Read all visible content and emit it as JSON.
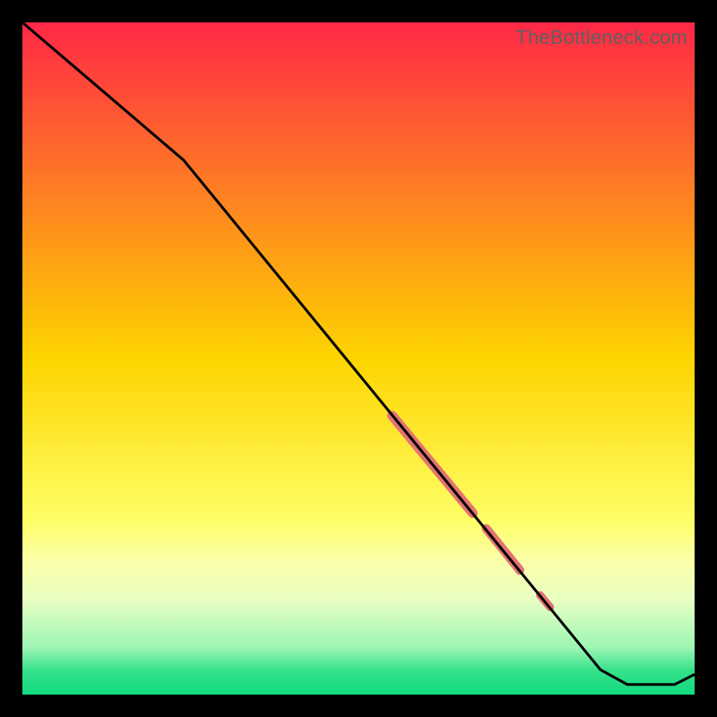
{
  "watermark": "TheBottleneck.com",
  "chart_data": {
    "type": "line",
    "title": "",
    "xlabel": "",
    "ylabel": "",
    "xlim": [
      0,
      100
    ],
    "ylim": [
      0,
      100
    ],
    "gradient_stops": [
      {
        "offset": 0.0,
        "color": "#ff2846"
      },
      {
        "offset": 0.5,
        "color": "#fdd400"
      },
      {
        "offset": 0.74,
        "color": "#ffff66"
      },
      {
        "offset": 0.8,
        "color": "#fbffa8"
      },
      {
        "offset": 0.86,
        "color": "#e8ffc3"
      },
      {
        "offset": 0.93,
        "color": "#9cf6b4"
      },
      {
        "offset": 0.965,
        "color": "#34e08b"
      },
      {
        "offset": 1.0,
        "color": "#11db7e"
      }
    ],
    "series": [
      {
        "name": "bottleneck-curve",
        "color": "#000000",
        "points": [
          {
            "x": 0.0,
            "y": 100.0
          },
          {
            "x": 24.0,
            "y": 79.5
          },
          {
            "x": 86.0,
            "y": 3.7
          },
          {
            "x": 90.0,
            "y": 1.5
          },
          {
            "x": 97.0,
            "y": 1.5
          },
          {
            "x": 100.0,
            "y": 3.0
          }
        ]
      }
    ],
    "highlight_segments": [
      {
        "x1": 55.0,
        "y1": 41.5,
        "x2": 67.0,
        "y2": 27.0,
        "width": 11
      },
      {
        "x1": 69.0,
        "y1": 24.7,
        "x2": 74.0,
        "y2": 18.5,
        "width": 10
      },
      {
        "x1": 77.0,
        "y1": 14.8,
        "x2": 78.5,
        "y2": 13.0,
        "width": 9
      }
    ],
    "highlight_color": "#e57373"
  }
}
